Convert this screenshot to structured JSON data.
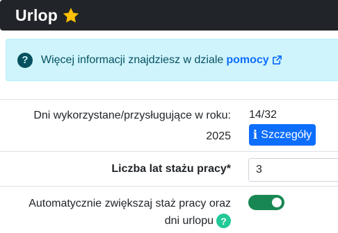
{
  "header": {
    "title": "Urlop"
  },
  "alert": {
    "text": "Więcej informacji znajdziesz w dziale",
    "link": "pomocy"
  },
  "rows": {
    "days": {
      "label_line1": "Dni wykorzystane/przysługujące w roku:",
      "label_line2": "2025",
      "value": "14/32",
      "button": "Szczegóły"
    },
    "seniority": {
      "label": "Liczba lat stażu pracy*",
      "value": "3"
    },
    "auto": {
      "label_line1": "Automatycznie zwiększaj staż pracy oraz",
      "label_line2": "dni urlopu",
      "toggle_on": true
    }
  },
  "colors": {
    "header_bg": "#212529",
    "alert_bg": "#cff4fc",
    "primary": "#0d6efd",
    "toggle_on": "#198754",
    "help": "#20c997"
  },
  "icons": {
    "header": "star-icon",
    "alert": "question-circle-icon",
    "link": "external-link-icon",
    "button": "info-icon",
    "help": "question-circle-icon"
  }
}
